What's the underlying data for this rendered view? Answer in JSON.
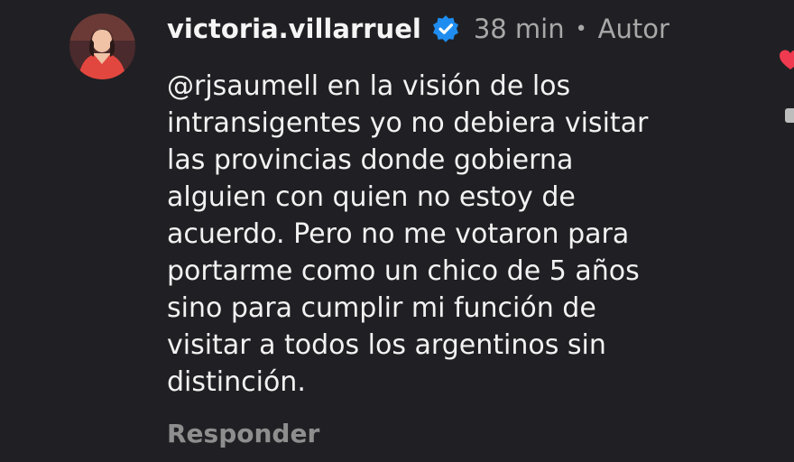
{
  "comment": {
    "username": "victoria.villarruel",
    "verified": true,
    "time": "38 min",
    "separator": "•",
    "author_badge": "Autor",
    "mention": "@rjsaumell",
    "lines": [
      " en la visión de los",
      "intransigentes yo no debiera visitar",
      "las provincias donde gobierna",
      "alguien con quien no estoy de",
      "acuerdo. Pero no me votaron para",
      "portarme como un chico de 5 años",
      "sino para cumplir mi función de",
      "visitar a todos los argentinos sin",
      "distinción."
    ],
    "reply_label": "Responder"
  },
  "icons": {
    "verified": "verified-badge-icon",
    "like": "heart-icon"
  },
  "colors": {
    "background": "#202024",
    "verified_blue": "#1f8df0",
    "heart_red": "#ef3a4f",
    "muted_text": "#a8a8a8"
  }
}
